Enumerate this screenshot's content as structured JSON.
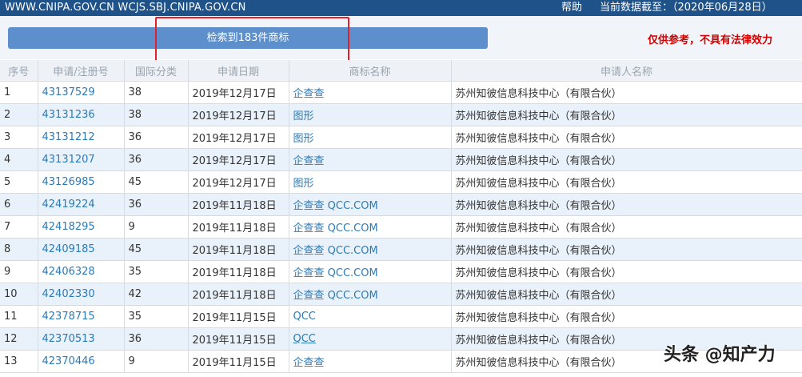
{
  "topbar": {
    "url": "WWW.CNIPA.GOV.CN WCJS.SBJ.CNIPA.GOV.CN",
    "help": "帮助",
    "asof": "当前数据截至：（2020年06月28日）"
  },
  "search_result": "检索到183件商标",
  "disclaimer": "仅供参考，不具有法律效力",
  "columns": [
    "序号",
    "申请/注册号",
    "国际分类",
    "申请日期",
    "商标名称",
    "申请人名称"
  ],
  "rows": [
    {
      "no": "1",
      "reg": "43137529",
      "cls": "38",
      "date": "2019年12月17日",
      "name": "企查查",
      "applicant": "苏州知彼信息科技中心（有限合伙）"
    },
    {
      "no": "2",
      "reg": "43131236",
      "cls": "38",
      "date": "2019年12月17日",
      "name": "图形",
      "applicant": "苏州知彼信息科技中心（有限合伙）"
    },
    {
      "no": "3",
      "reg": "43131212",
      "cls": "36",
      "date": "2019年12月17日",
      "name": "图形",
      "applicant": "苏州知彼信息科技中心（有限合伙）"
    },
    {
      "no": "4",
      "reg": "43131207",
      "cls": "36",
      "date": "2019年12月17日",
      "name": "企查查",
      "applicant": "苏州知彼信息科技中心（有限合伙）"
    },
    {
      "no": "5",
      "reg": "43126985",
      "cls": "45",
      "date": "2019年12月17日",
      "name": "图形",
      "applicant": "苏州知彼信息科技中心（有限合伙）"
    },
    {
      "no": "6",
      "reg": "42419224",
      "cls": "36",
      "date": "2019年11月18日",
      "name": "企查查 QCC.COM",
      "applicant": "苏州知彼信息科技中心（有限合伙）"
    },
    {
      "no": "7",
      "reg": "42418295",
      "cls": "9",
      "date": "2019年11月18日",
      "name": "企查查 QCC.COM",
      "applicant": "苏州知彼信息科技中心（有限合伙）"
    },
    {
      "no": "8",
      "reg": "42409185",
      "cls": "45",
      "date": "2019年11月18日",
      "name": "企查查 QCC.COM",
      "applicant": "苏州知彼信息科技中心（有限合伙）"
    },
    {
      "no": "9",
      "reg": "42406328",
      "cls": "35",
      "date": "2019年11月18日",
      "name": "企查查 QCC.COM",
      "applicant": "苏州知彼信息科技中心（有限合伙）"
    },
    {
      "no": "10",
      "reg": "42402330",
      "cls": "42",
      "date": "2019年11月18日",
      "name": "企查查 QCC.COM",
      "applicant": "苏州知彼信息科技中心（有限合伙）"
    },
    {
      "no": "11",
      "reg": "42378715",
      "cls": "35",
      "date": "2019年11月15日",
      "name": "QCC",
      "applicant": "苏州知彼信息科技中心（有限合伙）"
    },
    {
      "no": "12",
      "reg": "42370513",
      "cls": "36",
      "date": "2019年11月15日",
      "name": "QCC",
      "applicant": "苏州知彼信息科技中心（有限合伙）"
    },
    {
      "no": "13",
      "reg": "42370446",
      "cls": "9",
      "date": "2019年11月15日",
      "name": "企查查",
      "applicant": "苏州知彼信息科技中心（有限合伙）"
    }
  ],
  "watermark": "头条 @知产力",
  "colors": {
    "topbar": "#1e5288",
    "button": "#5d8fcc",
    "link": "#2a7ab8",
    "disclaimer": "#d40000",
    "highlight": "#e21f2b"
  }
}
